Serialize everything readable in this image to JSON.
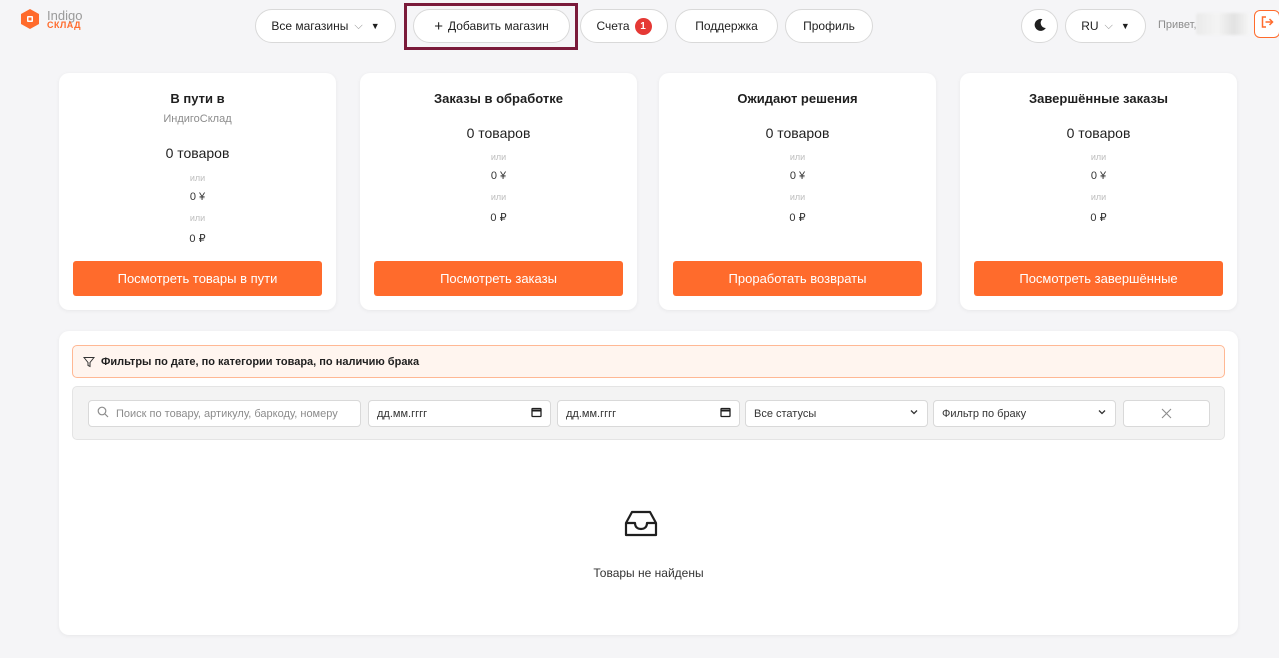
{
  "brand": {
    "title": "Indigo",
    "subtitle": "СКЛАД",
    "accent": "#ff6b2c"
  },
  "header": {
    "stores_label": "Все магазины",
    "add_store_label": "Добавить магазин",
    "bills_label": "Счета",
    "bills_badge": "1",
    "support_label": "Поддержка",
    "profile_label": "Профиль",
    "lang_label": "RU",
    "greeting": "Привет,"
  },
  "cards": [
    {
      "title": "В пути в",
      "subtitle": "ИндигоСклад",
      "qty": "0 товаров",
      "or1": "или",
      "val1": "0 ¥",
      "or2": "или",
      "val2": "0 ₽",
      "button": "Посмотреть товары в пути"
    },
    {
      "title": "Заказы в обработке",
      "qty": "0 товаров",
      "or1": "или",
      "val1": "0 ¥",
      "or2": "или",
      "val2": "0 ₽",
      "button": "Посмотреть заказы"
    },
    {
      "title": "Ожидают решения",
      "qty": "0 товаров",
      "or1": "или",
      "val1": "0 ¥",
      "or2": "или",
      "val2": "0 ₽",
      "button": "Проработать возвраты"
    },
    {
      "title": "Завершённые заказы",
      "qty": "0 товаров",
      "or1": "или",
      "val1": "0 ¥",
      "or2": "или",
      "val2": "0 ₽",
      "button": "Посмотреть завершённые"
    }
  ],
  "filters": {
    "banner": "Фильтры по дате, по категории товара, по наличию брака",
    "search_placeholder": "Поиск по товару, артикулу, баркоду, номеру",
    "date_from_placeholder": "дд.мм.гггг",
    "date_to_placeholder": "дд.мм.гггг",
    "status_value": "Все статусы",
    "defect_value": "Фильтр по браку"
  },
  "empty_state": {
    "text": "Товары не найдены"
  }
}
